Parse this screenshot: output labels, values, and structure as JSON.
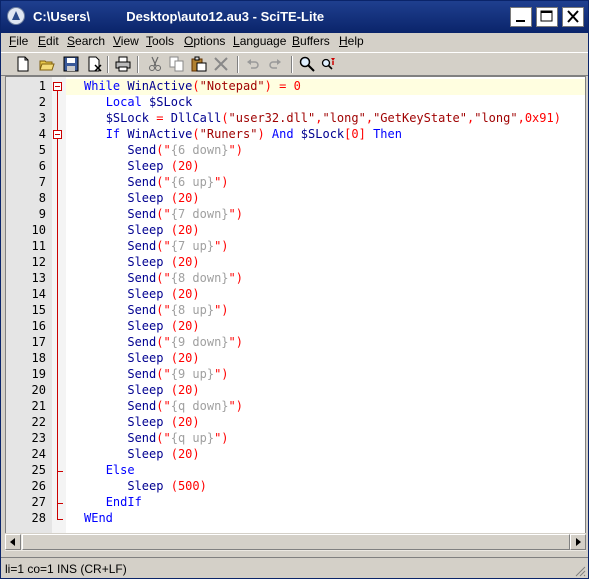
{
  "window": {
    "title": "C:\\Users\\          Desktop\\auto12.au3 - SciTE-Lite",
    "controls": {
      "minimize": "_",
      "maximize": "□",
      "close": "✕"
    }
  },
  "menu": [
    {
      "label": "File",
      "mnemonic": "F",
      "rest": "ile"
    },
    {
      "label": "Edit",
      "mnemonic": "E",
      "rest": "dit"
    },
    {
      "label": "Search",
      "mnemonic": "S",
      "rest": "earch"
    },
    {
      "label": "View",
      "mnemonic": "V",
      "rest": "iew"
    },
    {
      "label": "Tools",
      "mnemonic": "T",
      "rest": "ools"
    },
    {
      "label": "Options",
      "mnemonic": "O",
      "rest": "ptions"
    },
    {
      "label": "Language",
      "mnemonic": "L",
      "rest": "anguage"
    },
    {
      "label": "Buffers",
      "mnemonic": "B",
      "rest": "uffers"
    },
    {
      "label": "Help",
      "mnemonic": "H",
      "rest": "elp"
    }
  ],
  "toolbar": [
    "new-file-icon",
    "open-file-icon",
    "save-icon",
    "close-file-icon",
    "print-icon",
    "cut-icon",
    "copy-icon",
    "paste-icon",
    "delete-icon",
    "undo-icon",
    "redo-icon",
    "find-icon",
    "replace-icon"
  ],
  "editor": {
    "current_line": 1,
    "lines": [
      {
        "n": "1",
        "t": [
          [
            "kw",
            "While "
          ],
          [
            "fn",
            "WinActive"
          ],
          [
            "op",
            "("
          ],
          [
            "str",
            "\"Notepad\""
          ],
          [
            "op",
            ") = "
          ],
          [
            "num",
            "0"
          ]
        ]
      },
      {
        "n": "2",
        "t": [
          [
            "",
            "   "
          ],
          [
            "kw",
            "Local "
          ],
          [
            "fn",
            "$SLock"
          ]
        ]
      },
      {
        "n": "3",
        "t": [
          [
            "",
            "   "
          ],
          [
            "fn",
            "$SLock"
          ],
          [
            "op",
            " = "
          ],
          [
            "fn",
            "DllCall"
          ],
          [
            "op",
            "("
          ],
          [
            "str",
            "\"user32.dll\""
          ],
          [
            "op",
            ","
          ],
          [
            "str",
            "\"long\""
          ],
          [
            "op",
            ","
          ],
          [
            "str",
            "\"GetKeyState\""
          ],
          [
            "op",
            ","
          ],
          [
            "str",
            "\"long\""
          ],
          [
            "op",
            ","
          ],
          [
            "num",
            "0x91"
          ],
          [
            "op",
            ")"
          ]
        ]
      },
      {
        "n": "4",
        "t": [
          [
            "",
            "   "
          ],
          [
            "kw",
            "If "
          ],
          [
            "fn",
            "WinActive"
          ],
          [
            "op",
            "("
          ],
          [
            "str",
            "\"Runers\""
          ],
          [
            "op",
            ") "
          ],
          [
            "kw",
            "And "
          ],
          [
            "fn",
            "$SLock"
          ],
          [
            "op",
            "["
          ],
          [
            "num",
            "0"
          ],
          [
            "op",
            "] "
          ],
          [
            "kw",
            "Then"
          ]
        ]
      },
      {
        "n": "5",
        "t": [
          [
            "",
            "      "
          ],
          [
            "fn",
            "Send"
          ],
          [
            "op",
            "(\""
          ],
          [
            "sk",
            "{6 down}"
          ],
          [
            "op",
            "\")"
          ]
        ]
      },
      {
        "n": "6",
        "t": [
          [
            "",
            "      "
          ],
          [
            "fn",
            "Sleep "
          ],
          [
            "op",
            "("
          ],
          [
            "num",
            "20"
          ],
          [
            "op",
            ")"
          ]
        ]
      },
      {
        "n": "7",
        "t": [
          [
            "",
            "      "
          ],
          [
            "fn",
            "Send"
          ],
          [
            "op",
            "(\""
          ],
          [
            "sk",
            "{6 up}"
          ],
          [
            "op",
            "\")"
          ]
        ]
      },
      {
        "n": "8",
        "t": [
          [
            "",
            "      "
          ],
          [
            "fn",
            "Sleep "
          ],
          [
            "op",
            "("
          ],
          [
            "num",
            "20"
          ],
          [
            "op",
            ")"
          ]
        ]
      },
      {
        "n": "9",
        "t": [
          [
            "",
            "      "
          ],
          [
            "fn",
            "Send"
          ],
          [
            "op",
            "(\""
          ],
          [
            "sk",
            "{7 down}"
          ],
          [
            "op",
            "\")"
          ]
        ]
      },
      {
        "n": "10",
        "t": [
          [
            "",
            "      "
          ],
          [
            "fn",
            "Sleep "
          ],
          [
            "op",
            "("
          ],
          [
            "num",
            "20"
          ],
          [
            "op",
            ")"
          ]
        ]
      },
      {
        "n": "11",
        "t": [
          [
            "",
            "      "
          ],
          [
            "fn",
            "Send"
          ],
          [
            "op",
            "(\""
          ],
          [
            "sk",
            "{7 up}"
          ],
          [
            "op",
            "\")"
          ]
        ]
      },
      {
        "n": "12",
        "t": [
          [
            "",
            "      "
          ],
          [
            "fn",
            "Sleep "
          ],
          [
            "op",
            "("
          ],
          [
            "num",
            "20"
          ],
          [
            "op",
            ")"
          ]
        ]
      },
      {
        "n": "13",
        "t": [
          [
            "",
            "      "
          ],
          [
            "fn",
            "Send"
          ],
          [
            "op",
            "(\""
          ],
          [
            "sk",
            "{8 down}"
          ],
          [
            "op",
            "\")"
          ]
        ]
      },
      {
        "n": "14",
        "t": [
          [
            "",
            "      "
          ],
          [
            "fn",
            "Sleep "
          ],
          [
            "op",
            "("
          ],
          [
            "num",
            "20"
          ],
          [
            "op",
            ")"
          ]
        ]
      },
      {
        "n": "15",
        "t": [
          [
            "",
            "      "
          ],
          [
            "fn",
            "Send"
          ],
          [
            "op",
            "(\""
          ],
          [
            "sk",
            "{8 up}"
          ],
          [
            "op",
            "\")"
          ]
        ]
      },
      {
        "n": "16",
        "t": [
          [
            "",
            "      "
          ],
          [
            "fn",
            "Sleep "
          ],
          [
            "op",
            "("
          ],
          [
            "num",
            "20"
          ],
          [
            "op",
            ")"
          ]
        ]
      },
      {
        "n": "17",
        "t": [
          [
            "",
            "      "
          ],
          [
            "fn",
            "Send"
          ],
          [
            "op",
            "(\""
          ],
          [
            "sk",
            "{9 down}"
          ],
          [
            "op",
            "\")"
          ]
        ]
      },
      {
        "n": "18",
        "t": [
          [
            "",
            "      "
          ],
          [
            "fn",
            "Sleep "
          ],
          [
            "op",
            "("
          ],
          [
            "num",
            "20"
          ],
          [
            "op",
            ")"
          ]
        ]
      },
      {
        "n": "19",
        "t": [
          [
            "",
            "      "
          ],
          [
            "fn",
            "Send"
          ],
          [
            "op",
            "(\""
          ],
          [
            "sk",
            "{9 up}"
          ],
          [
            "op",
            "\")"
          ]
        ]
      },
      {
        "n": "20",
        "t": [
          [
            "",
            "      "
          ],
          [
            "fn",
            "Sleep "
          ],
          [
            "op",
            "("
          ],
          [
            "num",
            "20"
          ],
          [
            "op",
            ")"
          ]
        ]
      },
      {
        "n": "21",
        "t": [
          [
            "",
            "      "
          ],
          [
            "fn",
            "Send"
          ],
          [
            "op",
            "(\""
          ],
          [
            "sk",
            "{q down}"
          ],
          [
            "op",
            "\")"
          ]
        ]
      },
      {
        "n": "22",
        "t": [
          [
            "",
            "      "
          ],
          [
            "fn",
            "Sleep "
          ],
          [
            "op",
            "("
          ],
          [
            "num",
            "20"
          ],
          [
            "op",
            ")"
          ]
        ]
      },
      {
        "n": "23",
        "t": [
          [
            "",
            "      "
          ],
          [
            "fn",
            "Send"
          ],
          [
            "op",
            "(\""
          ],
          [
            "sk",
            "{q up}"
          ],
          [
            "op",
            "\")"
          ]
        ]
      },
      {
        "n": "24",
        "t": [
          [
            "",
            "      "
          ],
          [
            "fn",
            "Sleep "
          ],
          [
            "op",
            "("
          ],
          [
            "num",
            "20"
          ],
          [
            "op",
            ")"
          ]
        ]
      },
      {
        "n": "25",
        "t": [
          [
            "",
            "   "
          ],
          [
            "kw",
            "Else"
          ]
        ]
      },
      {
        "n": "26",
        "t": [
          [
            "",
            "      "
          ],
          [
            "fn",
            "Sleep "
          ],
          [
            "op",
            "("
          ],
          [
            "num",
            "500"
          ],
          [
            "op",
            ")"
          ]
        ]
      },
      {
        "n": "27",
        "t": [
          [
            "",
            "   "
          ],
          [
            "kw",
            "EndIf"
          ]
        ]
      },
      {
        "n": "28",
        "t": [
          [
            "kw",
            "WEnd"
          ]
        ]
      }
    ]
  },
  "status": {
    "text": "li=1 co=1 INS (CR+LF)"
  }
}
